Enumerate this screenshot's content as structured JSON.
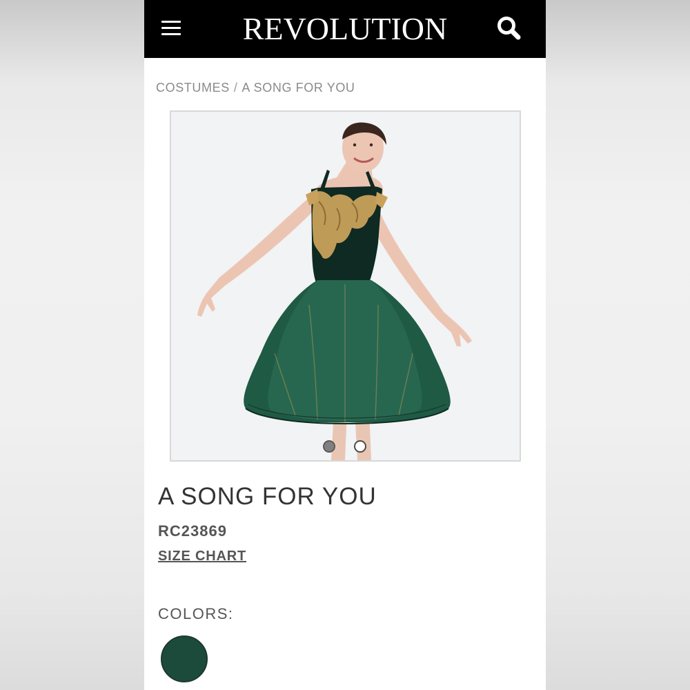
{
  "header": {
    "brand": "REVOLUTION",
    "menu_icon": "hamburger-menu-icon",
    "search_icon": "search-icon"
  },
  "breadcrumb": {
    "items": [
      "COSTUMES",
      "A SONG FOR YOU"
    ],
    "separator": "/"
  },
  "gallery": {
    "image_count": 2,
    "active_index": 1
  },
  "product": {
    "title": "A SONG FOR YOU",
    "sku": "RC23869",
    "size_chart_label": "SIZE CHART",
    "colors_label": "COLORS:",
    "colors": [
      {
        "hex": "#1c4a3b"
      }
    ]
  },
  "theme": {
    "header_bg": "#000000",
    "page_bg": "#ffffff",
    "muted_text": "#8a8a8a",
    "costume_green": "#1c4a3b",
    "costume_gold": "#c9a15c"
  }
}
